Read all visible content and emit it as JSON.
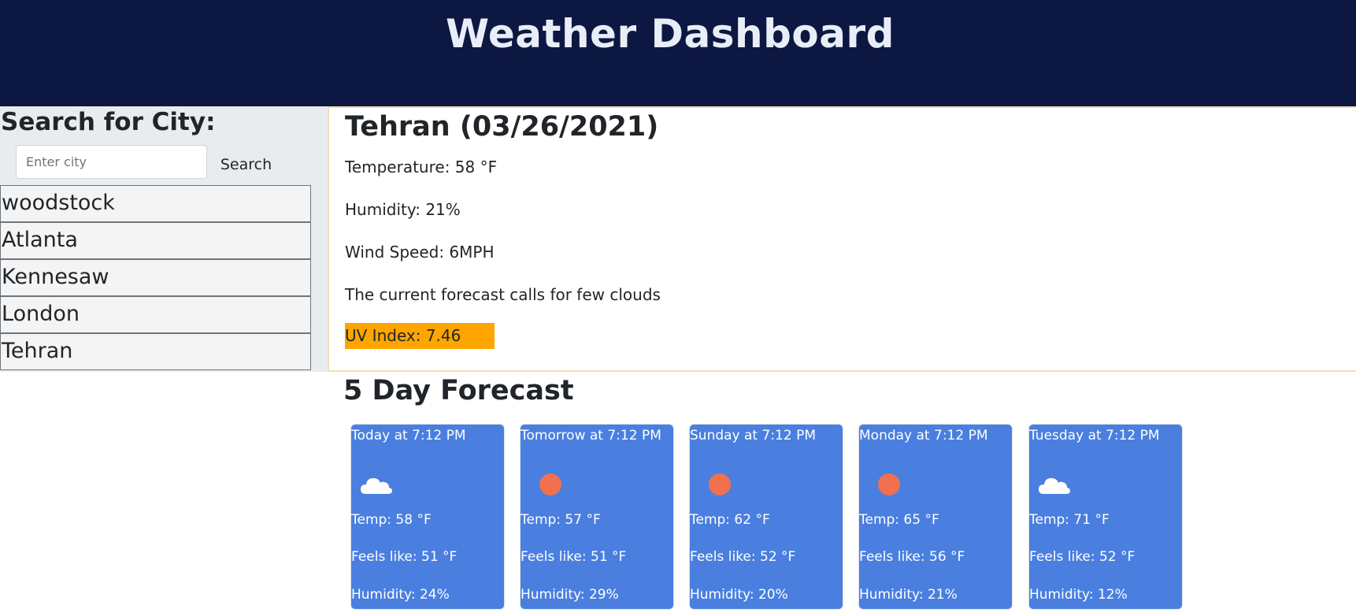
{
  "header": {
    "title": "Weather Dashboard"
  },
  "sidebar": {
    "heading": "Search for City:",
    "search_placeholder": "Enter city",
    "search_value": "",
    "search_button_label": "Search",
    "cities": [
      "woodstock",
      "Atlanta",
      "Kennesaw",
      "London",
      "Tehran"
    ]
  },
  "current": {
    "title": "Tehran (03/26/2021)",
    "temperature": "Temperature: 58 °F",
    "humidity": "Humidity: 21%",
    "wind": "Wind Speed: 6MPH",
    "forecast_text": "The current forecast calls for few clouds",
    "uv": "UV Index: 7.46"
  },
  "forecast": {
    "heading": "5 Day Forecast",
    "days": [
      {
        "day": "Today at 7:12 PM",
        "icon": "cloud-icon",
        "temp": "Temp: 58 °F",
        "feels": "Feels like: 51 °F",
        "humidity": "Humidity: 24%"
      },
      {
        "day": "Tomorrow at 7:12 PM",
        "icon": "sun-icon",
        "temp": "Temp: 57 °F",
        "feels": "Feels like: 51 °F",
        "humidity": "Humidity: 29%"
      },
      {
        "day": "Sunday at 7:12 PM",
        "icon": "sun-icon",
        "temp": "Temp: 62 °F",
        "feels": "Feels like: 52 °F",
        "humidity": "Humidity: 20%"
      },
      {
        "day": "Monday at 7:12 PM",
        "icon": "sun-icon",
        "temp": "Temp: 65 °F",
        "feels": "Feels like: 56 °F",
        "humidity": "Humidity: 21%"
      },
      {
        "day": "Tuesday at 7:12 PM",
        "icon": "cloud-icon",
        "temp": "Temp: 71 °F",
        "feels": "Feels like: 52 °F",
        "humidity": "Humidity: 12%"
      }
    ]
  },
  "colors": {
    "header_bg": "#0d1842",
    "card_bg": "#4a7fe0",
    "uv_bg": "#ffa500",
    "sun": "#f0704f",
    "cloud": "#ffffff"
  }
}
